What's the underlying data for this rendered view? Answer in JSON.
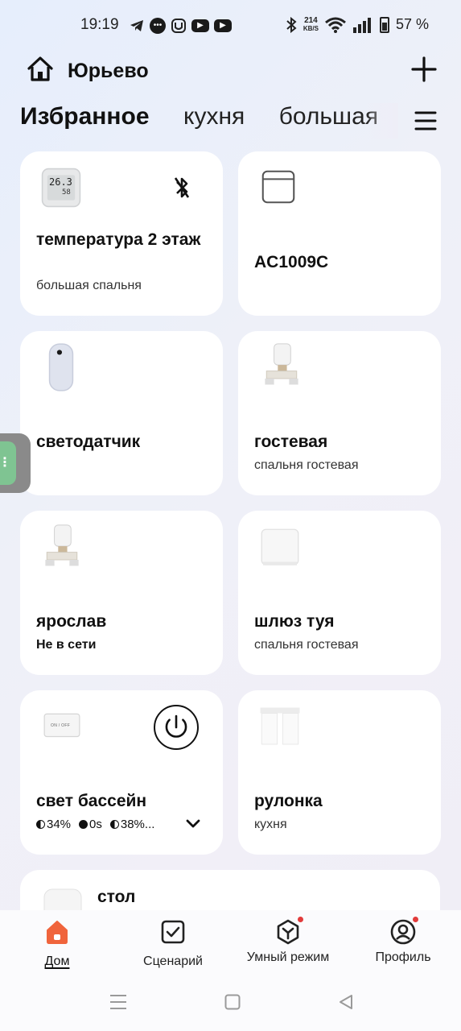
{
  "status_bar": {
    "time": "19:19",
    "net_speed_value": "214",
    "net_speed_unit": "KB/S",
    "battery": "57 %",
    "battery_level": 0.57,
    "app_icons": [
      "telegram-icon",
      "messenger-icon",
      "mi-home-icon",
      "youtube-icon",
      "youtube-icon"
    ]
  },
  "header": {
    "home_name": "Юрьево"
  },
  "tabs": [
    "Избранное",
    "кухня",
    "большая"
  ],
  "devices": [
    {
      "name": "температура 2 этаж",
      "room": "большая спальня",
      "icon": "thermometer-hygrometer-icon",
      "display_temp": "26.3",
      "display_hum": "58"
    },
    {
      "name": "AC1009C",
      "room": "",
      "icon": "window-panel-icon"
    },
    {
      "name": "светодатчик",
      "room": "",
      "icon": "light-sensor-icon"
    },
    {
      "name": "гостевая",
      "room": "спальня гостевая",
      "icon": "radiator-valve-icon"
    },
    {
      "name": "ярослав",
      "room": "Не в сети",
      "icon": "radiator-valve-icon"
    },
    {
      "name": "шлюз туя",
      "room": "спальня гостевая",
      "icon": "gateway-icon"
    },
    {
      "name": "свет бассейн",
      "icon": "dimmer-module-icon",
      "device_label": "ON / OFF",
      "stats": {
        "brightness": "34%",
        "delay": "0s",
        "level": "38%..."
      }
    },
    {
      "name": "рулонка",
      "room": "кухня",
      "icon": "roller-blind-icon"
    },
    {
      "name": "стол",
      "icon": "device-icon"
    }
  ],
  "bottom_nav": [
    {
      "label": "Дом",
      "icon": "home-icon",
      "active": true
    },
    {
      "label": "Сценарий",
      "icon": "scenario-check-icon"
    },
    {
      "label": "Умный режим",
      "icon": "smart-mode-icon",
      "badge": true
    },
    {
      "label": "Профиль",
      "icon": "profile-icon",
      "badge": true
    }
  ],
  "colors": {
    "accent": "#f0643c",
    "badge": "#e23b3b",
    "side_handle": "#7fc492"
  }
}
